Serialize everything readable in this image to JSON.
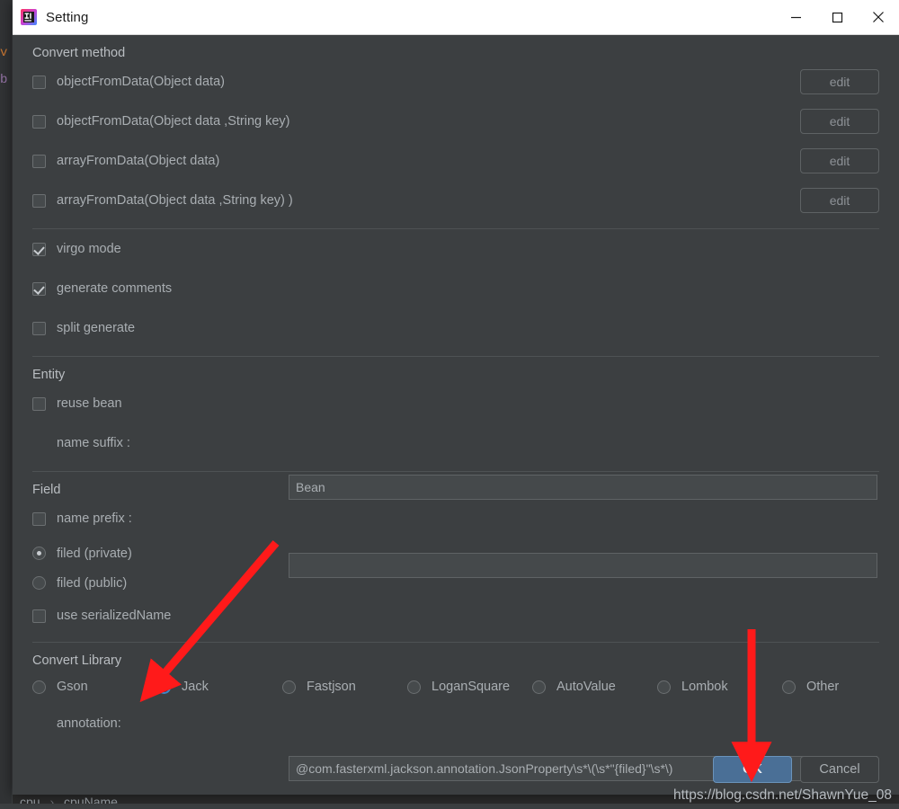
{
  "window": {
    "title": "Setting",
    "icon": "intellij-idea-icon",
    "controls": {
      "minimize": "minimize-icon",
      "maximize": "maximize-icon",
      "close": "close-icon"
    }
  },
  "background_ide": {
    "code_fragments": [
      "v",
      "b"
    ],
    "breadcrumb": [
      "cpu",
      "cpuName"
    ],
    "breadcrumb_separator": "›"
  },
  "sections": {
    "convert_method": {
      "title": "Convert method",
      "methods": [
        {
          "label": "objectFromData(Object data)",
          "checked": false,
          "button": "edit"
        },
        {
          "label": "objectFromData(Object data ,String key)",
          "checked": false,
          "button": "edit"
        },
        {
          "label": "arrayFromData(Object data)",
          "checked": false,
          "button": "edit"
        },
        {
          "label": "arrayFromData(Object data ,String key) )",
          "checked": false,
          "button": "edit"
        }
      ],
      "options": [
        {
          "label": "virgo mode",
          "checked": true
        },
        {
          "label": "generate comments",
          "checked": true
        },
        {
          "label": "split generate",
          "checked": false
        }
      ]
    },
    "entity": {
      "title": "Entity",
      "reuse_bean": {
        "label": "reuse bean",
        "checked": false
      },
      "name_suffix": {
        "label": "name suffix :",
        "value": "Bean",
        "placeholder": ""
      }
    },
    "field": {
      "title": "Field",
      "name_prefix": {
        "label": "name prefix :",
        "checked": false,
        "value": "",
        "placeholder": ""
      },
      "visibility": [
        {
          "label": "filed (private)",
          "selected": true
        },
        {
          "label": "filed (public)",
          "selected": false
        }
      ],
      "use_serialized_name": {
        "label": "use serializedName",
        "checked": false
      }
    },
    "convert_library": {
      "title": "Convert Library",
      "libraries": [
        {
          "label": "Gson",
          "selected": false
        },
        {
          "label": "Jack",
          "selected": true
        },
        {
          "label": "Fastjson",
          "selected": false
        },
        {
          "label": "LoganSquare",
          "selected": false
        },
        {
          "label": "AutoValue",
          "selected": false
        },
        {
          "label": "Lombok",
          "selected": false
        },
        {
          "label": "Other",
          "selected": false
        }
      ],
      "annotation": {
        "label": "annotation:",
        "value": "@com.fasterxml.jackson.annotation.JsonProperty\\s*\\(\\s*\"{filed}\"\\s*\\)",
        "placeholder": ""
      }
    }
  },
  "footer": {
    "ok_label": "OK",
    "cancel_label": "Cancel"
  },
  "watermark": "https://blog.csdn.net/ShawnYue_08",
  "colors": {
    "dialog_bg": "#3c3f41",
    "ide_bg": "#2b2b2b",
    "text": "#a9aeb2",
    "accent_blue": "#3e87c8",
    "ok_button": "#4a6f96",
    "annotation_arrow": "#ff1a1a"
  }
}
